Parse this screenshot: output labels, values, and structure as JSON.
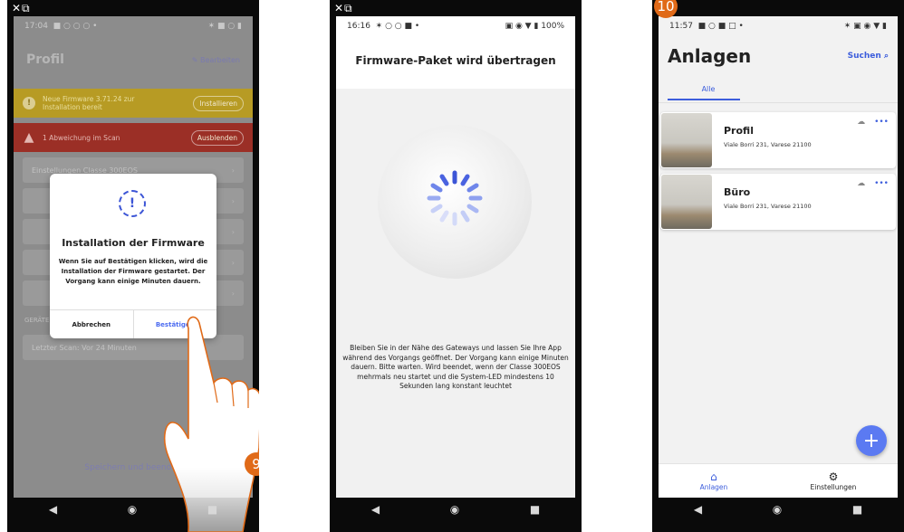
{
  "phone1": {
    "status": {
      "time": "17:04",
      "icons": "■ ○ ○ ○ •",
      "right": "✶ ■ ○ ▮"
    },
    "title": "Profil",
    "edit_label": "Bearbeiten",
    "firmware_banner": {
      "text": "Neue Firmware 3.71.24 zur Installation bereit",
      "button": "Installieren"
    },
    "deviation_banner": {
      "text": "1 Abweichung im Scan",
      "button": "Ausblenden"
    },
    "rows": [
      "Einstellungen Classe 300EOS",
      "",
      "",
      "",
      ""
    ],
    "section": "GERÄTE",
    "last_scan": "Letzter Scan: Vor 24 Minuten",
    "save": "Speichern und beenden",
    "dialog": {
      "icon": "!",
      "title": "Installation der Firmware",
      "text": "Wenn Sie auf Bestätigen klicken, wird die Installation der Firmware gestartet. Der Vorgang kann einige Minuten dauern.",
      "cancel": "Abbrechen",
      "confirm": "Bestätigen"
    },
    "step": "9"
  },
  "phone2": {
    "status": {
      "time": "16:16",
      "icons": "✶ ○ ○ ■ •",
      "battery": "100%"
    },
    "title": "Firmware-Paket wird übertragen",
    "message": "Bleiben Sie in der Nähe des Gateways und lassen Sie Ihre App während des Vorgangs geöffnet. Der Vorgang kann einige Minuten dauern. Bitte warten. Wird beendet, wenn der Classe 300EOS mehrmals neu startet und die System-LED mindestens 10 Sekunden lang konstant leuchtet"
  },
  "phone3": {
    "status": {
      "time": "11:57",
      "icons": "■ ○ ■ □ •"
    },
    "title": "Anlagen",
    "search": "Suchen",
    "tab": "Alle",
    "plants": [
      {
        "name": "Profil",
        "address": "Viale Borri 231, Varese 21100"
      },
      {
        "name": "Büro",
        "address": "Viale Borri 231, Varese 21100"
      }
    ],
    "fab": "+",
    "bottom_tabs": [
      "Anlagen",
      "Einstellungen"
    ],
    "step": "10"
  },
  "nav": {
    "back": "◀",
    "home": "◉",
    "recent": "■"
  },
  "colors": {
    "accent": "#3c5ddc",
    "step_badge": "#e06a18",
    "warning": "#b79b24",
    "error": "#9b2f26"
  }
}
